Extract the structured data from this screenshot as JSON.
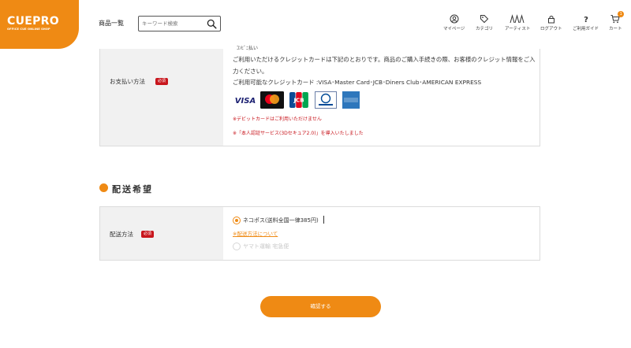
{
  "header": {
    "logo_main": "CUEPRO",
    "logo_sub": "OFFICE CUE ONLINE SHOP",
    "products_link": "商品一覧",
    "search_placeholder": "キーワード検索",
    "nav": {
      "mypage": "マイページ",
      "category": "カテゴリ",
      "artist": "アーティスト",
      "logout": "ログアウト",
      "guide": "ご利用ガイド",
      "cart": "カート",
      "cart_count": "1"
    }
  },
  "payment": {
    "label": "お支払い方法",
    "required": "必須",
    "cut_text": "ｺﾝﾋﾞﾆ払い",
    "line1": "ご利用いただけるクレジットカードは下記のとおりです。商品のご購入手続きの際、お客様のクレジット情報をご入",
    "line2": "力ください。",
    "line3": "ご利用可能なクレジットカード :VISA･Master Card･JCB･Diners Club･AMERICAN EXPRESS",
    "cards": [
      "visa-logo",
      "mastercard-logo",
      "jcb-logo",
      "diners-club-logo",
      "amex-logo"
    ],
    "note_debit": "※デビットカードはご利用いただけません",
    "note_3ds": "※「本人認証サービス(3Dセキュア2.0)」を導入いたしました"
  },
  "delivery": {
    "section_title": "配送希望",
    "label": "配送方法",
    "required": "必須",
    "option1": "ネコポス(送料全国一律385円)",
    "option1_selected": true,
    "link": "※配送方法について",
    "option2": "ヤマト運輸 宅急便",
    "option2_enabled": false
  },
  "confirm_button": "確認する",
  "colors": {
    "accent": "#ef8a14",
    "required_red": "#c8161d",
    "label_bg": "#f1f1f1"
  }
}
